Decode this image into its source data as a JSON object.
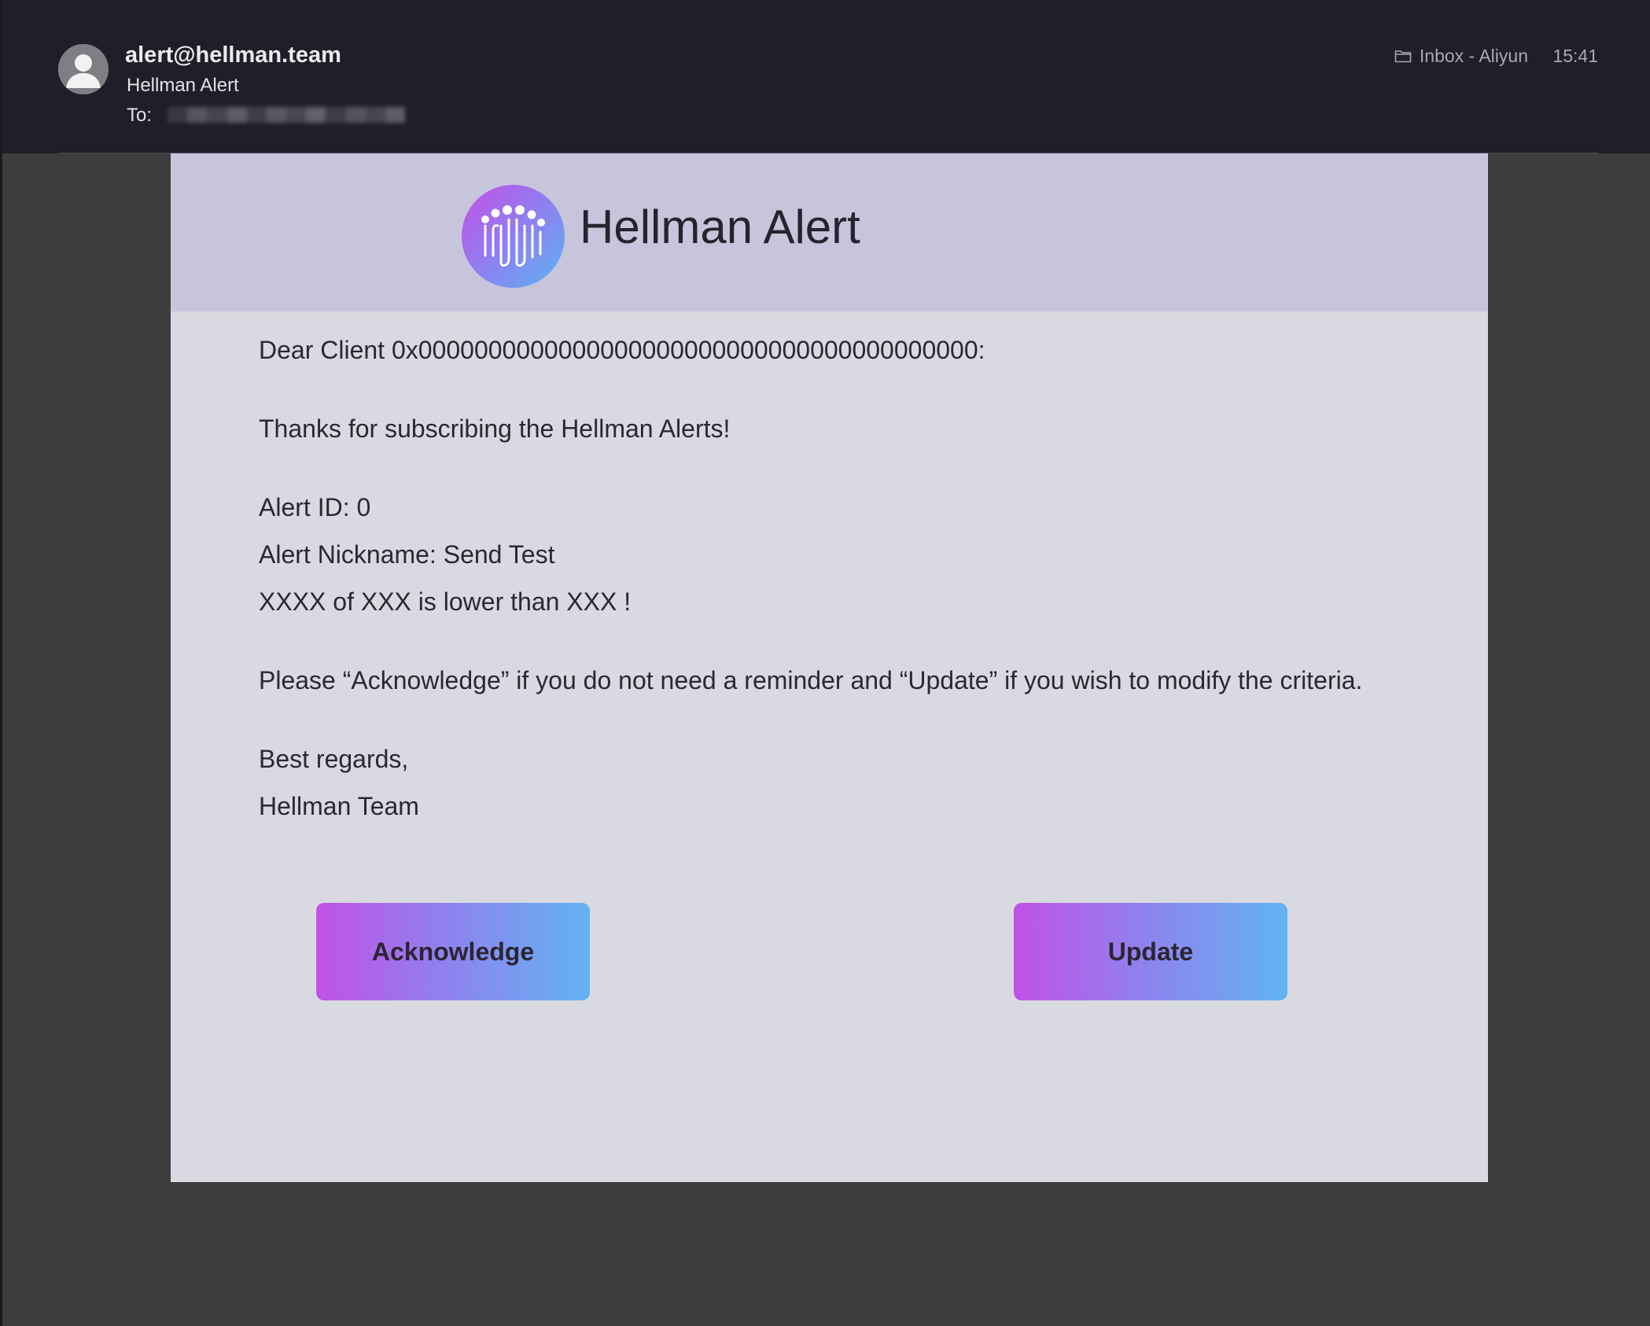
{
  "header": {
    "sender_email": "alert@hellman.team",
    "sender_name": "Hellman Alert",
    "to_label": "To:",
    "mailbox": "Inbox - Aliyun",
    "time": "15:41"
  },
  "email": {
    "banner_title": "Hellman Alert",
    "greeting": "Dear Client 0x0000000000000000000000000000000000000000:",
    "thanks": "Thanks for subscribing the Hellman Alerts!",
    "alert_id": "Alert ID: 0",
    "alert_nickname": "Alert Nickname: Send Test",
    "alert_condition": "XXXX of XXX is lower than XXX !",
    "instructions": "Please “Acknowledge” if you do not need a reminder and “Update” if you wish to modify the criteria.",
    "closing": "Best regards,",
    "signature": "Hellman Team",
    "acknowledge_label": "Acknowledge",
    "update_label": "Update"
  },
  "colors": {
    "header_bg": "#201e29",
    "banner_bg": "#c6c5dc",
    "card_bg": "#d9d9e1",
    "gradient_start": "#c052e7",
    "gradient_end": "#62b3f2"
  },
  "icons": {
    "avatar": "person-avatar-icon",
    "mailbox": "folder-icon",
    "logo": "hellman-logo-icon"
  }
}
